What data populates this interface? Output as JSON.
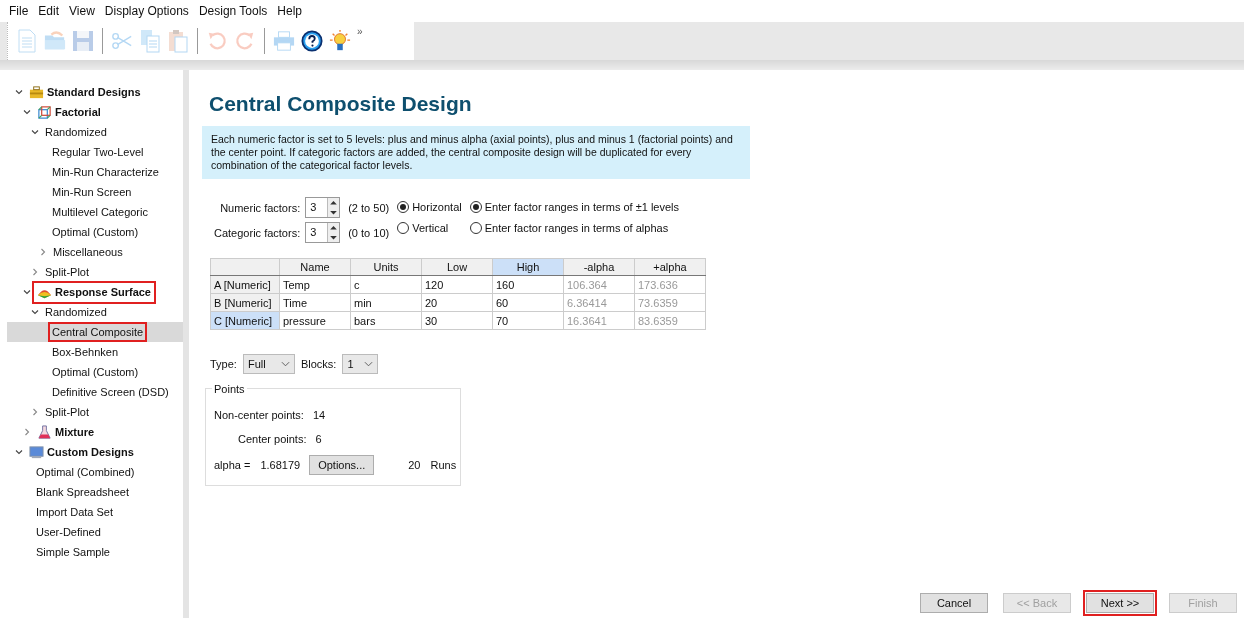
{
  "menu": [
    "File",
    "Edit",
    "View",
    "Display Options",
    "Design Tools",
    "Help"
  ],
  "toolbar": [
    {
      "kind": "new",
      "disabled": true
    },
    {
      "kind": "open",
      "disabled": true
    },
    {
      "kind": "save",
      "disabled": true
    },
    {
      "kind": "sep"
    },
    {
      "kind": "cut",
      "disabled": true
    },
    {
      "kind": "copy",
      "disabled": true
    },
    {
      "kind": "paste",
      "disabled": true
    },
    {
      "kind": "sep"
    },
    {
      "kind": "undo",
      "disabled": true
    },
    {
      "kind": "redo",
      "disabled": true
    },
    {
      "kind": "sep"
    },
    {
      "kind": "print",
      "disabled": true
    },
    {
      "kind": "help",
      "disabled": false
    },
    {
      "kind": "bulb",
      "disabled": false
    }
  ],
  "toolbar_overflow": "»",
  "tree": [
    {
      "label": "Standard Designs",
      "kind": "toolbox",
      "expanded": true,
      "highlighted": false,
      "children": [
        {
          "label": "Factorial",
          "kind": "cube",
          "expanded": true,
          "highlighted": false,
          "children": [
            {
              "label": "Randomized",
              "kind": "item",
              "expanded": true,
              "children": [
                {
                  "label": "Regular Two-Level",
                  "selected": false
                },
                {
                  "label": "Min-Run Characterize",
                  "selected": false
                },
                {
                  "label": "Min-Run Screen",
                  "selected": false
                },
                {
                  "label": "Multilevel Categoric",
                  "selected": false
                },
                {
                  "label": "Optimal (Custom)",
                  "selected": false
                },
                {
                  "label": "Miscellaneous",
                  "kind": "item",
                  "expanded": false
                }
              ]
            },
            {
              "label": "Split-Plot",
              "kind": "item",
              "expanded": false
            }
          ]
        },
        {
          "label": "Response Surface",
          "kind": "surface",
          "expanded": true,
          "highlighted": true,
          "children": [
            {
              "label": "Randomized",
              "kind": "item",
              "expanded": true,
              "children": [
                {
                  "label": "Central Composite",
                  "selected": true,
                  "highlighted": true
                },
                {
                  "label": "Box-Behnken",
                  "selected": false
                },
                {
                  "label": "Optimal (Custom)",
                  "selected": false
                },
                {
                  "label": "Definitive Screen (DSD)",
                  "selected": false
                }
              ]
            },
            {
              "label": "Split-Plot",
              "kind": "item",
              "expanded": false
            }
          ]
        },
        {
          "label": "Mixture",
          "kind": "flask",
          "expanded": false,
          "highlighted": false
        }
      ]
    },
    {
      "label": "Custom Designs",
      "kind": "monitor",
      "expanded": true,
      "highlighted": false,
      "children": [
        {
          "label": "Optimal (Combined)",
          "selected": false
        },
        {
          "label": "Blank Spreadsheet",
          "selected": false
        },
        {
          "label": "Import Data Set",
          "selected": false
        },
        {
          "label": "User-Defined",
          "selected": false
        },
        {
          "label": "Simple Sample",
          "selected": false
        }
      ]
    }
  ],
  "title": "Central Composite Design",
  "info": "Each numeric factor is set to 5 levels: plus and minus alpha (axial points), plus and minus 1 (factorial points) and the center point. If categoric factors are added, the central composite design will be duplicated for every combination of the categorical factor levels.",
  "spinners": [
    {
      "label": "Numeric factors:",
      "value": "3",
      "range": "(2 to 50)"
    },
    {
      "label": "Categoric factors:",
      "value": "3",
      "range": "(0 to 10)"
    }
  ],
  "layout_options": [
    {
      "label": "Horizontal",
      "selected": true
    },
    {
      "label": "Vertical",
      "selected": false
    }
  ],
  "range_options": [
    {
      "label": "Enter factor ranges in terms of ±1 levels",
      "selected": true
    },
    {
      "label": "Enter factor ranges in terms of alphas",
      "selected": false
    }
  ],
  "table": {
    "columns": [
      {
        "label": "Name",
        "selected": false,
        "readonly": false
      },
      {
        "label": "Units",
        "selected": false,
        "readonly": false
      },
      {
        "label": "Low",
        "selected": false,
        "readonly": false
      },
      {
        "label": "High",
        "selected": true,
        "readonly": false
      },
      {
        "label": "-alpha",
        "selected": false,
        "readonly": true
      },
      {
        "label": "+alpha",
        "selected": false,
        "readonly": true
      }
    ],
    "rows": [
      {
        "header": "A [Numeric]",
        "selected": false,
        "cells": [
          "Temp",
          "c",
          "120",
          "160",
          "106.364",
          "173.636"
        ]
      },
      {
        "header": "B [Numeric]",
        "selected": false,
        "cells": [
          "Time",
          "min",
          "20",
          "60",
          "6.36414",
          "73.6359"
        ]
      },
      {
        "header": "C [Numeric]",
        "selected": true,
        "cells": [
          "pressure",
          "bars",
          "30",
          "70",
          "16.3641",
          "83.6359"
        ]
      }
    ]
  },
  "type": {
    "label": "Type:",
    "value": "Full"
  },
  "blocks": {
    "label": "Blocks:",
    "value": "1"
  },
  "points": {
    "title": "Points",
    "non_center_label": "Non-center points:",
    "non_center": "14",
    "center_label": "Center points:",
    "center": "6",
    "alpha_label": "alpha =",
    "alpha": "1.68179",
    "options_button": "Options...",
    "runs": "20",
    "runs_label": "Runs"
  },
  "buttons": [
    {
      "label": "Cancel",
      "disabled": false,
      "highlighted": false
    },
    {
      "label": "<< Back",
      "disabled": true,
      "highlighted": false
    },
    {
      "label": "Next >>",
      "disabled": false,
      "highlighted": true
    },
    {
      "label": "Finish",
      "disabled": true,
      "highlighted": false
    }
  ]
}
